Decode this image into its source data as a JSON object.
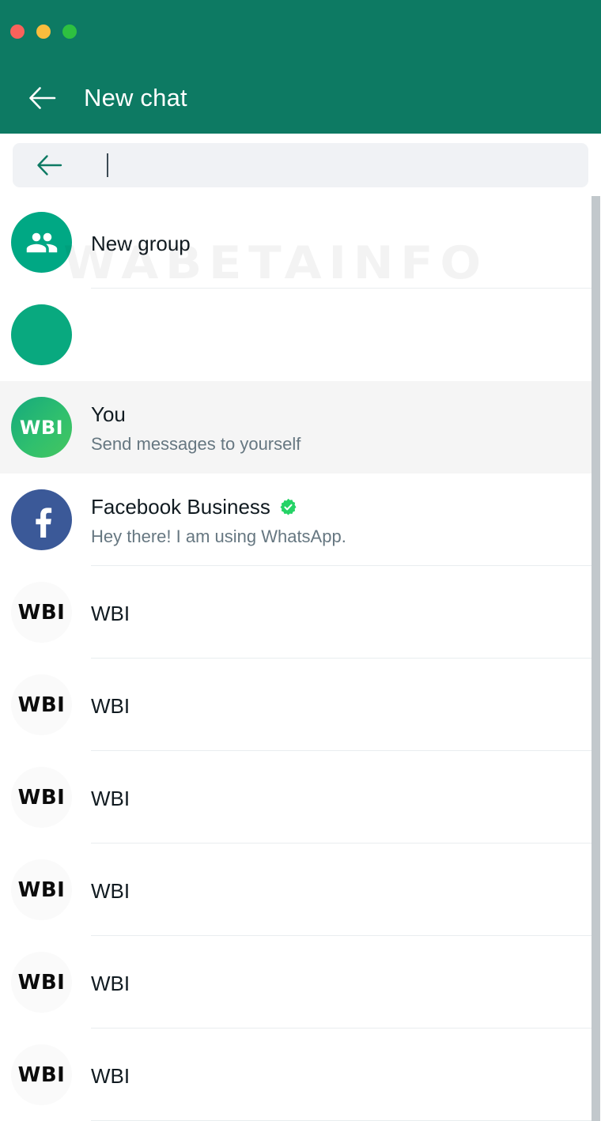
{
  "window": {
    "traffic_lights": [
      {
        "name": "close",
        "color": "#f9625b"
      },
      {
        "name": "minimize",
        "color": "#f9bd3d"
      },
      {
        "name": "maximize",
        "color": "#2ec040"
      }
    ],
    "header_color": "#0d7a63"
  },
  "header": {
    "title": "New chat",
    "back_icon": "arrow-left-icon"
  },
  "search": {
    "value": "",
    "placeholder": "",
    "back_icon": "arrow-left-icon"
  },
  "watermark": {
    "text": "WABETAINFO"
  },
  "list": {
    "rows": [
      {
        "id": "new-group",
        "title": "New group",
        "subtitle": "",
        "avatar_kind": "group",
        "avatar_text": "",
        "verified": false,
        "selected": false,
        "divider": true
      },
      {
        "id": "blank-contact",
        "title": "",
        "subtitle": "",
        "avatar_kind": "plain",
        "avatar_text": "",
        "verified": false,
        "selected": false,
        "divider": false
      },
      {
        "id": "you",
        "title": "You",
        "subtitle": "Send messages to yourself",
        "avatar_kind": "you",
        "avatar_text": "WBI",
        "verified": false,
        "selected": true,
        "divider": false
      },
      {
        "id": "facebook-business",
        "title": "Facebook Business",
        "subtitle": "Hey there! I am using WhatsApp.",
        "avatar_kind": "fb",
        "avatar_text": "f",
        "verified": true,
        "selected": false,
        "divider": true
      },
      {
        "id": "wbi-1",
        "title": "WBI",
        "subtitle": "",
        "avatar_kind": "wbi",
        "avatar_text": "WBI",
        "verified": false,
        "selected": false,
        "divider": true
      },
      {
        "id": "wbi-2",
        "title": "WBI",
        "subtitle": "",
        "avatar_kind": "wbi",
        "avatar_text": "WBI",
        "verified": false,
        "selected": false,
        "divider": true
      },
      {
        "id": "wbi-3",
        "title": "WBI",
        "subtitle": "",
        "avatar_kind": "wbi",
        "avatar_text": "WBI",
        "verified": false,
        "selected": false,
        "divider": true
      },
      {
        "id": "wbi-4",
        "title": "WBI",
        "subtitle": "",
        "avatar_kind": "wbi",
        "avatar_text": "WBI",
        "verified": false,
        "selected": false,
        "divider": true
      },
      {
        "id": "wbi-5",
        "title": "WBI",
        "subtitle": "",
        "avatar_kind": "wbi",
        "avatar_text": "WBI",
        "verified": false,
        "selected": false,
        "divider": true
      },
      {
        "id": "wbi-6",
        "title": "WBI",
        "subtitle": "",
        "avatar_kind": "wbi",
        "avatar_text": "WBI",
        "verified": false,
        "selected": false,
        "divider": true
      }
    ]
  }
}
